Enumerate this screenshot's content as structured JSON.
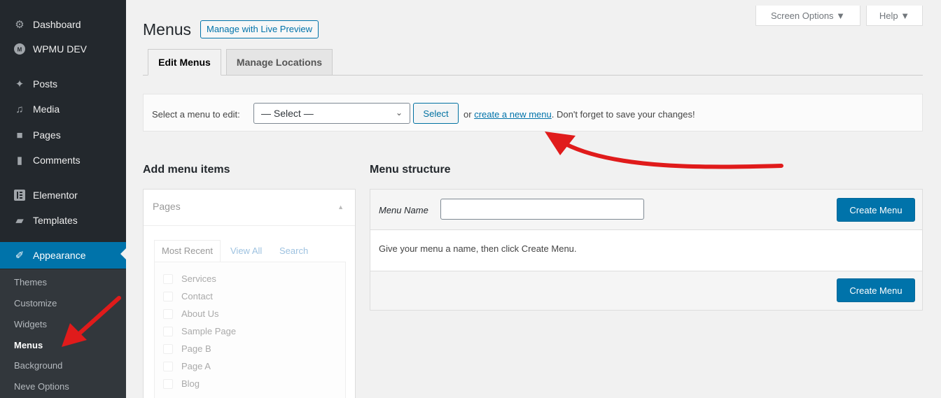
{
  "sidebar": {
    "items": [
      {
        "label": "Dashboard",
        "icon": "dashboard-icon"
      },
      {
        "label": "WPMU DEV",
        "icon": "wpmudev-icon"
      },
      {
        "label": "Posts",
        "icon": "pin-icon"
      },
      {
        "label": "Media",
        "icon": "media-icon"
      },
      {
        "label": "Pages",
        "icon": "pages-icon"
      },
      {
        "label": "Comments",
        "icon": "comment-icon"
      },
      {
        "label": "Elementor",
        "icon": "elementor-icon"
      },
      {
        "label": "Templates",
        "icon": "folder-icon"
      },
      {
        "label": "Appearance",
        "icon": "brush-icon"
      }
    ],
    "submenu": [
      "Themes",
      "Customize",
      "Widgets",
      "Menus",
      "Background",
      "Neve Options"
    ]
  },
  "header": {
    "title": "Menus",
    "live_preview_label": "Manage with Live Preview",
    "screen_options_label": "Screen Options ▼",
    "help_label": "Help ▼"
  },
  "tabs": [
    "Edit Menus",
    "Manage Locations"
  ],
  "select_bar": {
    "label": "Select a menu to edit:",
    "select_value": "— Select —",
    "select_button": "Select",
    "note_prefix": "or",
    "create_link": "create a new menu",
    "note_suffix": ". Don't forget to save your changes!"
  },
  "add_items": {
    "heading": "Add menu items",
    "box_title": "Pages",
    "tabs": [
      "Most Recent",
      "View All",
      "Search"
    ],
    "pages": [
      "Services",
      "Contact",
      "About Us",
      "Sample Page",
      "Page B",
      "Page A",
      "Blog"
    ]
  },
  "structure": {
    "heading": "Menu structure",
    "name_label": "Menu Name",
    "name_value": "",
    "create_button": "Create Menu",
    "instructions": "Give your menu a name, then click Create Menu."
  },
  "colors": {
    "sidebar_bg": "#23282d",
    "accent": "#0073aa",
    "annotation_red": "#e01b1b"
  }
}
